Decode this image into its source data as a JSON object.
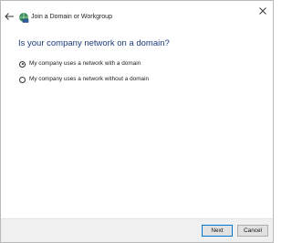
{
  "window": {
    "title": "Join a Domain or Workgroup"
  },
  "main": {
    "heading": "Is your company network on a domain?",
    "options": [
      {
        "label": "My company uses a network with a domain",
        "selected": true
      },
      {
        "label": "My company uses a network without a domain",
        "selected": false
      }
    ]
  },
  "footer": {
    "next_label": "Next",
    "cancel_label": "Cancel"
  },
  "colors": {
    "heading": "#1c3a7a",
    "accent": "#0078d7",
    "footer_bg": "#f0f0f0"
  },
  "icons": {
    "back": "back-arrow-icon",
    "app": "network-computer-icon",
    "close": "close-icon"
  }
}
